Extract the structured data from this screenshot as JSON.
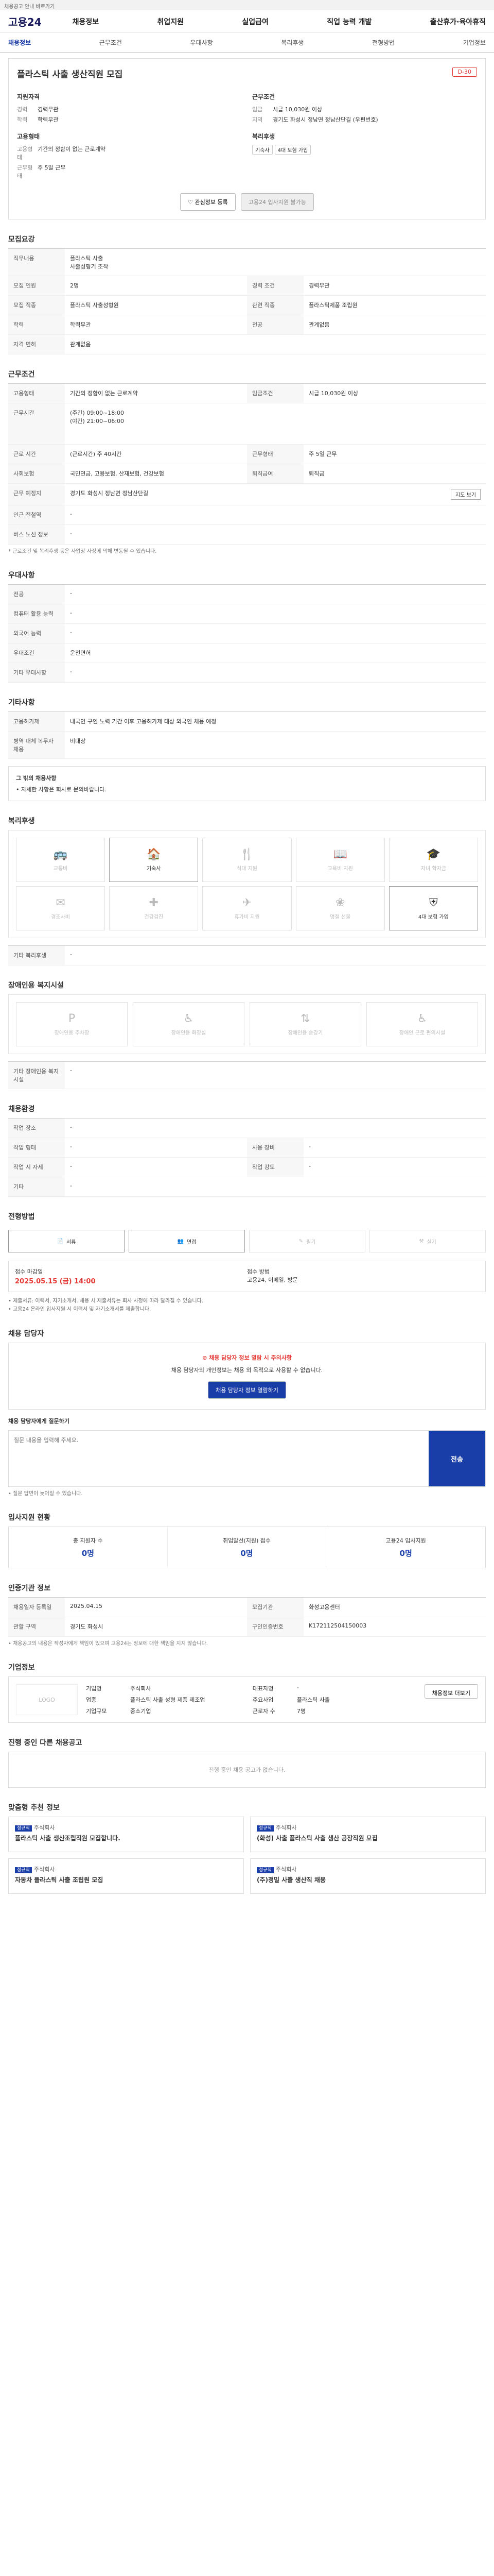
{
  "topbar": {
    "text": "채용공고 안내 바로가기"
  },
  "header": {
    "logo": "고용24",
    "gnb": [
      "채용정보",
      "취업지원",
      "실업급여",
      "직업 능력 개발",
      "출산휴가·육아휴직"
    ]
  },
  "tabs": [
    "채용정보",
    "근무조건",
    "우대사항",
    "복리후생",
    "전형방법",
    "기업정보"
  ],
  "job": {
    "title": "플라스틱 사출 생산직원 모집",
    "dday": "D-30",
    "qual_title": "지원자격",
    "career_k": "경력",
    "career_v": "경력무관",
    "edu_k": "학력",
    "edu_v": "학력무관",
    "emp_title": "고용형태",
    "emp_k": "고용형태",
    "emp_v": "기간의 정함이 없는 근로계약",
    "shift_k": "근무형태",
    "shift_v": "주 5일 근무",
    "cond_title": "근무조건",
    "wage_k": "임금",
    "wage_v": "시급 10,030원 이상",
    "loc_k": "지역",
    "loc_v": "경기도 화성시 정남면 정남산단길 (우편번호)",
    "welfare_title": "복리후생",
    "welfare_chips": [
      "기숙사",
      "4대 보험 가입"
    ],
    "btn_scrap": "관심정보 등록",
    "btn_apply": "고용24 입사지원 불가능"
  },
  "recruit": {
    "title": "모집요강",
    "job_k": "직무내용",
    "job_v": "플라스틱 사출\n사출성형기 조작",
    "rows": [
      {
        "k": "모집 인원",
        "v": "2명",
        "k2": "경력 조건",
        "v2": "경력무관"
      },
      {
        "k": "모집 직종",
        "v": "플라스틱 사출성형원",
        "k2": "관련 직종",
        "v2": "플라스틱제품 조립원"
      },
      {
        "k": "학력",
        "v": "학력무관",
        "k2": "전공",
        "v2": "관계없음"
      },
      {
        "k": "자격 면허",
        "v": "관계없음",
        "k2": "",
        "v2": ""
      }
    ]
  },
  "work": {
    "title": "근무조건",
    "type_k": "고용형태",
    "type_v": "기간의 정함이 없는 근로계약",
    "wage_k": "임금조건",
    "wage_v": "시급 10,030원 이상",
    "time_k": "근무시간",
    "time_v": "(주간) 09:00~18:00\n(야간) 21:00~06:00",
    "hours_k": "근로 시간",
    "hours_v": "(근로시간) 주 40시간",
    "shift_k": "근무형태",
    "shift_v": "주 5일 근무",
    "ins_k": "사회보험",
    "ins_v": "국민연금, 고용보험, 산재보험, 건강보험",
    "ret_k": "퇴직급여",
    "ret_v": "퇴직금",
    "place_k": "근무 예정지",
    "place_v": "경기도 화성시 정남면 정남산단길",
    "map_btn": "지도 보기",
    "train_k": "인근 전철역",
    "train_v": "-",
    "bus_k": "버스 노선 정보",
    "bus_v": "-",
    "note": "* 근로조건 및 복리후생 등은 사업장 사정에 의해 변동될 수 있습니다."
  },
  "pref": {
    "title": "우대사항",
    "rows": [
      {
        "k": "전공",
        "v": "-"
      },
      {
        "k": "컴퓨터 활용 능력",
        "v": "-"
      },
      {
        "k": "외국어 능력",
        "v": "-"
      },
      {
        "k": "우대조건",
        "v": "운전면허"
      },
      {
        "k": "기타 우대사항",
        "v": "-"
      }
    ]
  },
  "extra": {
    "title": "기타사항",
    "rows": [
      {
        "k": "고용허가제",
        "v": "내국인 구인 노력 기간 이후 고용허가제 대상 외국인 채용 예정"
      },
      {
        "k": "병역 대체 복무자 채용",
        "v": "비대상"
      }
    ],
    "misc_title": "그 밖의 채용사항",
    "misc_v": "• 자세한 사항은 회사로 문의바랍니다."
  },
  "welfare": {
    "title": "복리후생",
    "items": [
      {
        "label": "교통비",
        "on": false
      },
      {
        "label": "기숙사",
        "on": true
      },
      {
        "label": "식대 지원",
        "on": false
      },
      {
        "label": "교육비 지원",
        "on": false
      },
      {
        "label": "자녀 학자금",
        "on": false
      },
      {
        "label": "경조사비",
        "on": false
      },
      {
        "label": "건강검진",
        "on": false
      },
      {
        "label": "휴가비 지원",
        "on": false
      },
      {
        "label": "명절 선물",
        "on": false
      },
      {
        "label": "4대 보험 가입",
        "on": true
      }
    ],
    "other_k": "기타 복리후생",
    "other_v": "-"
  },
  "disab": {
    "title": "장애인용 복지시설",
    "items": [
      "장애인용 주차장",
      "장애인용 화장실",
      "장애인용 승강기",
      "장애인 근로 편의시설"
    ],
    "other_k": "기타 장애인용 복지시설",
    "other_v": "-"
  },
  "cond": {
    "title": "채용환경",
    "rows": [
      {
        "k": "작업 장소",
        "v": "-",
        "k2": "",
        "v2": ""
      },
      {
        "k": "작업 형태",
        "v": "-",
        "k2": "사용 장비",
        "v2": "-"
      },
      {
        "k": "작업 시 자세",
        "v": "-",
        "k2": "작업 강도",
        "v2": "-"
      },
      {
        "k": "기타",
        "v": "-",
        "k2": "",
        "v2": ""
      }
    ]
  },
  "method": {
    "title": "전형방법",
    "items": [
      "서류",
      "면접",
      "필기",
      "실기"
    ],
    "deadline_k": "접수 마감일",
    "deadline_v": "2025.05.15 (금) 14:00",
    "apply_k": "접수 방법",
    "apply_v": "고용24, 이메일, 방문",
    "notes": "• 제출서류: 이력서, 자기소개서. 채용 시 제출서류는 회사 사정에 따라 달라질 수 있습니다.\n• 고용24 온라인 입사지원 시 이력서 및 자기소개서를 제출합니다."
  },
  "contact": {
    "title": "채용 담당자",
    "alert": "채용 담당자 정보 열람 시 주의사항",
    "desc": "채용 담당자의 개인정보는 채용 외 목적으로 사용할 수 없습니다.",
    "btn_show": "채용 담당자 정보 열람하기",
    "inq_title": "채용 담당자에게 질문하기",
    "inq_ph": "질문 내용을 입력해 주세요.",
    "inq_btn": "전송",
    "inq_note": "• 질문 답변이 늦어질 수 있습니다."
  },
  "stats": {
    "title": "입사지원 현황",
    "items": [
      {
        "label": "총 지원자 수",
        "v": "0명"
      },
      {
        "label": "취업알선(지원) 접수",
        "v": "0명"
      },
      {
        "label": "고용24 입사지원",
        "v": "0명"
      }
    ]
  },
  "info": {
    "title": "인증기관 정보",
    "rows": [
      {
        "k": "채용일자 등록일",
        "v": "2025.04.15",
        "k2": "모집기관",
        "v2": "화성고용센터"
      },
      {
        "k": "관할 구역",
        "v": "경기도 화성시",
        "k2": "구인인증번호",
        "v2": "K172112504150003"
      }
    ],
    "note": "• 채용공고의 내용은 작성자에게 책임이 있으며 고용24는 정보에 대한 책임을 지지 않습니다."
  },
  "company": {
    "title": "기업정보",
    "logo": "LOGO",
    "rows": [
      {
        "k": "기업명",
        "v": "주식회사",
        "k2": "대표자명",
        "v2": "-"
      },
      {
        "k": "업종",
        "v": "플라스틱 사출 성형 제품 제조업",
        "k2": "주요사업",
        "v2": "플라스틱 사출"
      },
      {
        "k": "기업규모",
        "v": "중소기업",
        "k2": "근로자 수",
        "v2": "7명"
      }
    ],
    "btn": "채용정보 더보기"
  },
  "others": {
    "title": "진행 중인 다른 채용공고",
    "empty": "진행 중인 채용 공고가 없습니다."
  },
  "recs": {
    "title": "맞춤형 추천 정보",
    "items": [
      {
        "co": "주식회사",
        "tt": "플라스틱 사출 생산조립직원 모집합니다.",
        "badge": "정규직"
      },
      {
        "co": "주식회사",
        "tt": "(화성) 사출 플라스틱 사출 생산 공장직원 모집",
        "badge": "정규직"
      },
      {
        "co": "주식회사",
        "tt": "자동차 플라스틱 사출 조립원 모집",
        "badge": "정규직"
      },
      {
        "co": "주식회사",
        "tt": "(주)정밀 사출 생산직 채용",
        "badge": "정규직"
      }
    ]
  }
}
